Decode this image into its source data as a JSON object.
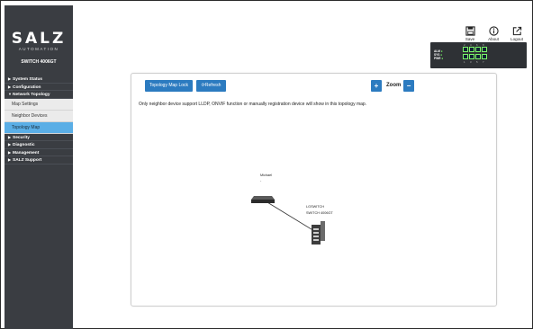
{
  "sidebar": {
    "brand": "SALZ",
    "brand_sub": "AUTOMATION",
    "model": "SWITCH 4006GT",
    "nav": [
      {
        "label": "System Status",
        "arrow": "▶"
      },
      {
        "label": "Configuration",
        "arrow": "▶"
      },
      {
        "label": "Network Topology",
        "arrow": "▼"
      }
    ],
    "sub_items": [
      {
        "label": "Map Settings"
      },
      {
        "label": "Neighbor Devices"
      },
      {
        "label": "Topology Map"
      }
    ],
    "nav_after": [
      {
        "label": "Security",
        "arrow": "▶"
      },
      {
        "label": "Diagnostic",
        "arrow": "▶"
      },
      {
        "label": "Management",
        "arrow": "▶"
      },
      {
        "label": "SALZ Support",
        "arrow": "▶"
      }
    ]
  },
  "toolbar": {
    "save_label": "Save",
    "about_label": "About",
    "logout_label": "Logout"
  },
  "status_panel": {
    "legend": [
      "ALM",
      "SYS",
      "PWR"
    ],
    "ports_top": [
      "2",
      "4",
      "6",
      "8"
    ],
    "ports_bottom": [
      "1",
      "3",
      "5",
      "7"
    ]
  },
  "topology": {
    "lock_button": "Topology Map Lock",
    "refresh_button": "Refresh",
    "refresh_icon": "refresh-icon",
    "zoom_in_label": "+",
    "zoom_label": "Zoom",
    "zoom_out_label": "−",
    "info_text": "Only neighbor device support LLDP, ONVIF function or manually registration device will show in this topology map.",
    "device_a": {
      "name": "Michael",
      "sub": "-"
    },
    "device_b": {
      "name": "LGSWITCH",
      "sub": "SWITCH 4006GT"
    }
  },
  "colors": {
    "accent": "#2c7bc0",
    "sidebar_bg": "#3a3d42",
    "active_item": "#5aaee6",
    "led_green": "#7cfc6a"
  }
}
